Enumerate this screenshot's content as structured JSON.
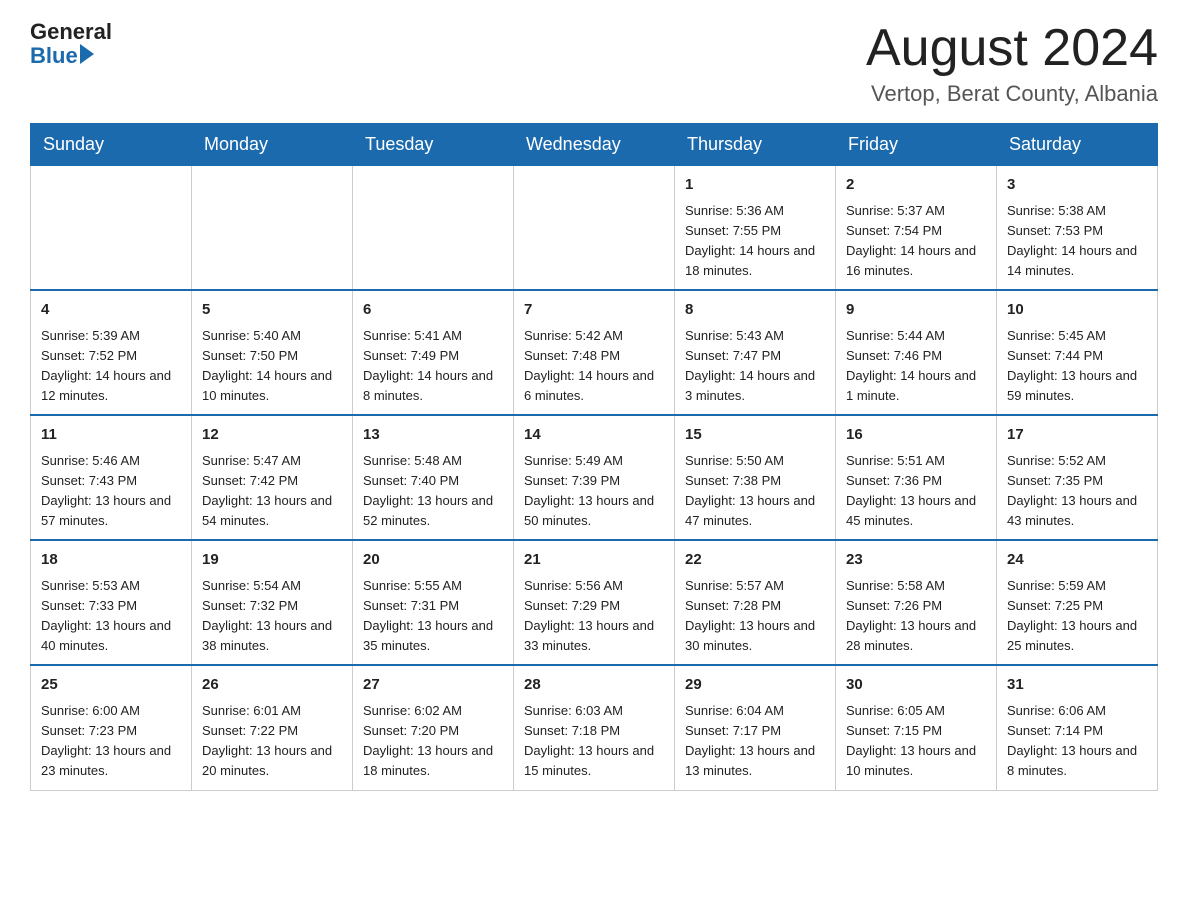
{
  "header": {
    "logo_general": "General",
    "logo_blue": "Blue",
    "month_title": "August 2024",
    "location": "Vertop, Berat County, Albania"
  },
  "calendar": {
    "days_of_week": [
      "Sunday",
      "Monday",
      "Tuesday",
      "Wednesday",
      "Thursday",
      "Friday",
      "Saturday"
    ],
    "weeks": [
      [
        {
          "day": "",
          "info": ""
        },
        {
          "day": "",
          "info": ""
        },
        {
          "day": "",
          "info": ""
        },
        {
          "day": "",
          "info": ""
        },
        {
          "day": "1",
          "info": "Sunrise: 5:36 AM\nSunset: 7:55 PM\nDaylight: 14 hours and 18 minutes."
        },
        {
          "day": "2",
          "info": "Sunrise: 5:37 AM\nSunset: 7:54 PM\nDaylight: 14 hours and 16 minutes."
        },
        {
          "day": "3",
          "info": "Sunrise: 5:38 AM\nSunset: 7:53 PM\nDaylight: 14 hours and 14 minutes."
        }
      ],
      [
        {
          "day": "4",
          "info": "Sunrise: 5:39 AM\nSunset: 7:52 PM\nDaylight: 14 hours and 12 minutes."
        },
        {
          "day": "5",
          "info": "Sunrise: 5:40 AM\nSunset: 7:50 PM\nDaylight: 14 hours and 10 minutes."
        },
        {
          "day": "6",
          "info": "Sunrise: 5:41 AM\nSunset: 7:49 PM\nDaylight: 14 hours and 8 minutes."
        },
        {
          "day": "7",
          "info": "Sunrise: 5:42 AM\nSunset: 7:48 PM\nDaylight: 14 hours and 6 minutes."
        },
        {
          "day": "8",
          "info": "Sunrise: 5:43 AM\nSunset: 7:47 PM\nDaylight: 14 hours and 3 minutes."
        },
        {
          "day": "9",
          "info": "Sunrise: 5:44 AM\nSunset: 7:46 PM\nDaylight: 14 hours and 1 minute."
        },
        {
          "day": "10",
          "info": "Sunrise: 5:45 AM\nSunset: 7:44 PM\nDaylight: 13 hours and 59 minutes."
        }
      ],
      [
        {
          "day": "11",
          "info": "Sunrise: 5:46 AM\nSunset: 7:43 PM\nDaylight: 13 hours and 57 minutes."
        },
        {
          "day": "12",
          "info": "Sunrise: 5:47 AM\nSunset: 7:42 PM\nDaylight: 13 hours and 54 minutes."
        },
        {
          "day": "13",
          "info": "Sunrise: 5:48 AM\nSunset: 7:40 PM\nDaylight: 13 hours and 52 minutes."
        },
        {
          "day": "14",
          "info": "Sunrise: 5:49 AM\nSunset: 7:39 PM\nDaylight: 13 hours and 50 minutes."
        },
        {
          "day": "15",
          "info": "Sunrise: 5:50 AM\nSunset: 7:38 PM\nDaylight: 13 hours and 47 minutes."
        },
        {
          "day": "16",
          "info": "Sunrise: 5:51 AM\nSunset: 7:36 PM\nDaylight: 13 hours and 45 minutes."
        },
        {
          "day": "17",
          "info": "Sunrise: 5:52 AM\nSunset: 7:35 PM\nDaylight: 13 hours and 43 minutes."
        }
      ],
      [
        {
          "day": "18",
          "info": "Sunrise: 5:53 AM\nSunset: 7:33 PM\nDaylight: 13 hours and 40 minutes."
        },
        {
          "day": "19",
          "info": "Sunrise: 5:54 AM\nSunset: 7:32 PM\nDaylight: 13 hours and 38 minutes."
        },
        {
          "day": "20",
          "info": "Sunrise: 5:55 AM\nSunset: 7:31 PM\nDaylight: 13 hours and 35 minutes."
        },
        {
          "day": "21",
          "info": "Sunrise: 5:56 AM\nSunset: 7:29 PM\nDaylight: 13 hours and 33 minutes."
        },
        {
          "day": "22",
          "info": "Sunrise: 5:57 AM\nSunset: 7:28 PM\nDaylight: 13 hours and 30 minutes."
        },
        {
          "day": "23",
          "info": "Sunrise: 5:58 AM\nSunset: 7:26 PM\nDaylight: 13 hours and 28 minutes."
        },
        {
          "day": "24",
          "info": "Sunrise: 5:59 AM\nSunset: 7:25 PM\nDaylight: 13 hours and 25 minutes."
        }
      ],
      [
        {
          "day": "25",
          "info": "Sunrise: 6:00 AM\nSunset: 7:23 PM\nDaylight: 13 hours and 23 minutes."
        },
        {
          "day": "26",
          "info": "Sunrise: 6:01 AM\nSunset: 7:22 PM\nDaylight: 13 hours and 20 minutes."
        },
        {
          "day": "27",
          "info": "Sunrise: 6:02 AM\nSunset: 7:20 PM\nDaylight: 13 hours and 18 minutes."
        },
        {
          "day": "28",
          "info": "Sunrise: 6:03 AM\nSunset: 7:18 PM\nDaylight: 13 hours and 15 minutes."
        },
        {
          "day": "29",
          "info": "Sunrise: 6:04 AM\nSunset: 7:17 PM\nDaylight: 13 hours and 13 minutes."
        },
        {
          "day": "30",
          "info": "Sunrise: 6:05 AM\nSunset: 7:15 PM\nDaylight: 13 hours and 10 minutes."
        },
        {
          "day": "31",
          "info": "Sunrise: 6:06 AM\nSunset: 7:14 PM\nDaylight: 13 hours and 8 minutes."
        }
      ]
    ]
  }
}
